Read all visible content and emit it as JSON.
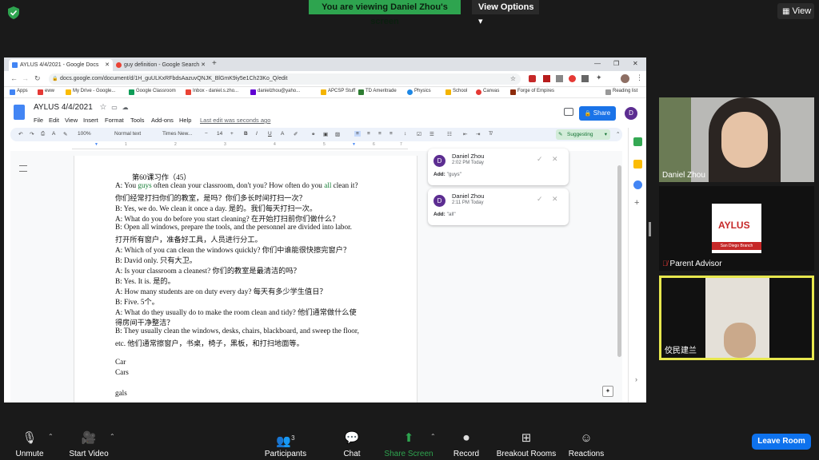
{
  "zoom": {
    "banner": "You are viewing Daniel Zhou's screen",
    "view_options": "View Options ▾",
    "view_button": "View",
    "participants_count": "3",
    "toolbar": {
      "unmute": "Unmute",
      "start_video": "Start Video",
      "participants": "Participants",
      "chat": "Chat",
      "share_screen": "Share Screen",
      "record": "Record",
      "breakout_rooms": "Breakout Rooms",
      "reactions": "Reactions",
      "leave_room": "Leave Room"
    },
    "tiles": [
      {
        "name": "Daniel Zhou"
      },
      {
        "name": "Parent Advisor"
      },
      {
        "name": "佼民建兰"
      }
    ],
    "aylus_card": {
      "title": "AYLUS",
      "subtitle": "San Diego Branch"
    }
  },
  "browser": {
    "tabs": [
      {
        "label": "AYLUS 4/4/2021 - Google Docs"
      },
      {
        "label": "guy definition - Google Search"
      }
    ],
    "url": "docs.google.com/document/d/1H_guULKxRFbdsAazuvQNJK_BlGmK9iy5e1Ch23Ko_Q/edit",
    "bookmarks": [
      "Apps",
      "eww",
      "My Drive - Google...",
      "Google Classroom",
      "Inbox - daniel.s.zho...",
      "danielzhou@yaho...",
      "APCSP Stuff",
      "TD Ameritrade",
      "Physics",
      "School",
      "Canvas",
      "Forge of Empires"
    ],
    "reading_list": "Reading list"
  },
  "docs": {
    "title": "AYLUS 4/4/2021",
    "menu": [
      "File",
      "Edit",
      "View",
      "Insert",
      "Format",
      "Tools",
      "Add-ons",
      "Help"
    ],
    "last_edit": "Last edit was seconds ago",
    "share": "Share",
    "avatar": "D",
    "toolbar": {
      "zoom": "100%",
      "style": "Normal text",
      "font": "Times New...",
      "size": "14",
      "mode": "Suggesting"
    },
    "ruler": [
      "1",
      "2",
      "3",
      "4",
      "5",
      "6",
      "7"
    ],
    "lines": [
      {
        "text": "第60课习作（45）"
      },
      {
        "pre": "A: You ",
        "sug": "guys",
        "post": " often clean your classroom, don't you? How often do you ",
        "sug2": "all",
        "post2": " clean it?"
      },
      {
        "text": "你们经常打扫你们的教室，是吗？你们多长时间打扫一次？"
      },
      {
        "text": "B: Yes, we do. We clean it once a day. 是的。我们每天打扫一次。"
      },
      {
        "text": "A: What do you do before you start cleaning? 在开始打扫前你们做什么？"
      },
      {
        "text": " B: Open all windows, prepare the tools, and the personnel are divided into labor."
      },
      {
        "text": "打开所有窗户，准备好工具，人员进行分工。"
      },
      {
        "text": "A: Which of you can clean the windows quickly? 你们中谁能很快擦完窗户？"
      },
      {
        "text": "B: David only. 只有大卫。"
      },
      {
        "text": "A: Is your classroom a cleanest? 你们的教室是最清洁的吗？"
      },
      {
        "text": "B: Yes. It is. 是的。"
      },
      {
        "text": "A: How many students are on duty every day? 每天有多少学生值日？"
      },
      {
        "text": "B: Five. 5个。"
      },
      {
        "text": "A: What do they usually do to make the room clean and tidy? 他们通常做什么使"
      },
      {
        "text": "得房间干净整洁？"
      },
      {
        "text": "B: They usually clean the windows, desks, chairs, blackboard, and sweep the floor,"
      },
      {
        "text": "etc. 他们通常擦窗户，书桌，椅子，黑板，和打扫地面等。"
      },
      {
        "text": ""
      },
      {
        "text": "Car"
      },
      {
        "text": "Cars"
      },
      {
        "text": ""
      },
      {
        "text": "gals"
      }
    ],
    "comments": [
      {
        "name": "Daniel Zhou",
        "time": "2:02 PM Today",
        "add_label": "Add:",
        "add_value": "\"guys\""
      },
      {
        "name": "Daniel Zhou",
        "time": "2:11 PM Today",
        "add_label": "Add:",
        "add_value": "\"all\""
      }
    ]
  },
  "colors": {
    "zoom_green": "#2ea44f",
    "zoom_blue": "#0e72ed",
    "docs_blue": "#1a73e8",
    "suggestion_green": "#188038",
    "avatar_purple": "#5c2d91",
    "active_speaker": "#e8e84e"
  }
}
